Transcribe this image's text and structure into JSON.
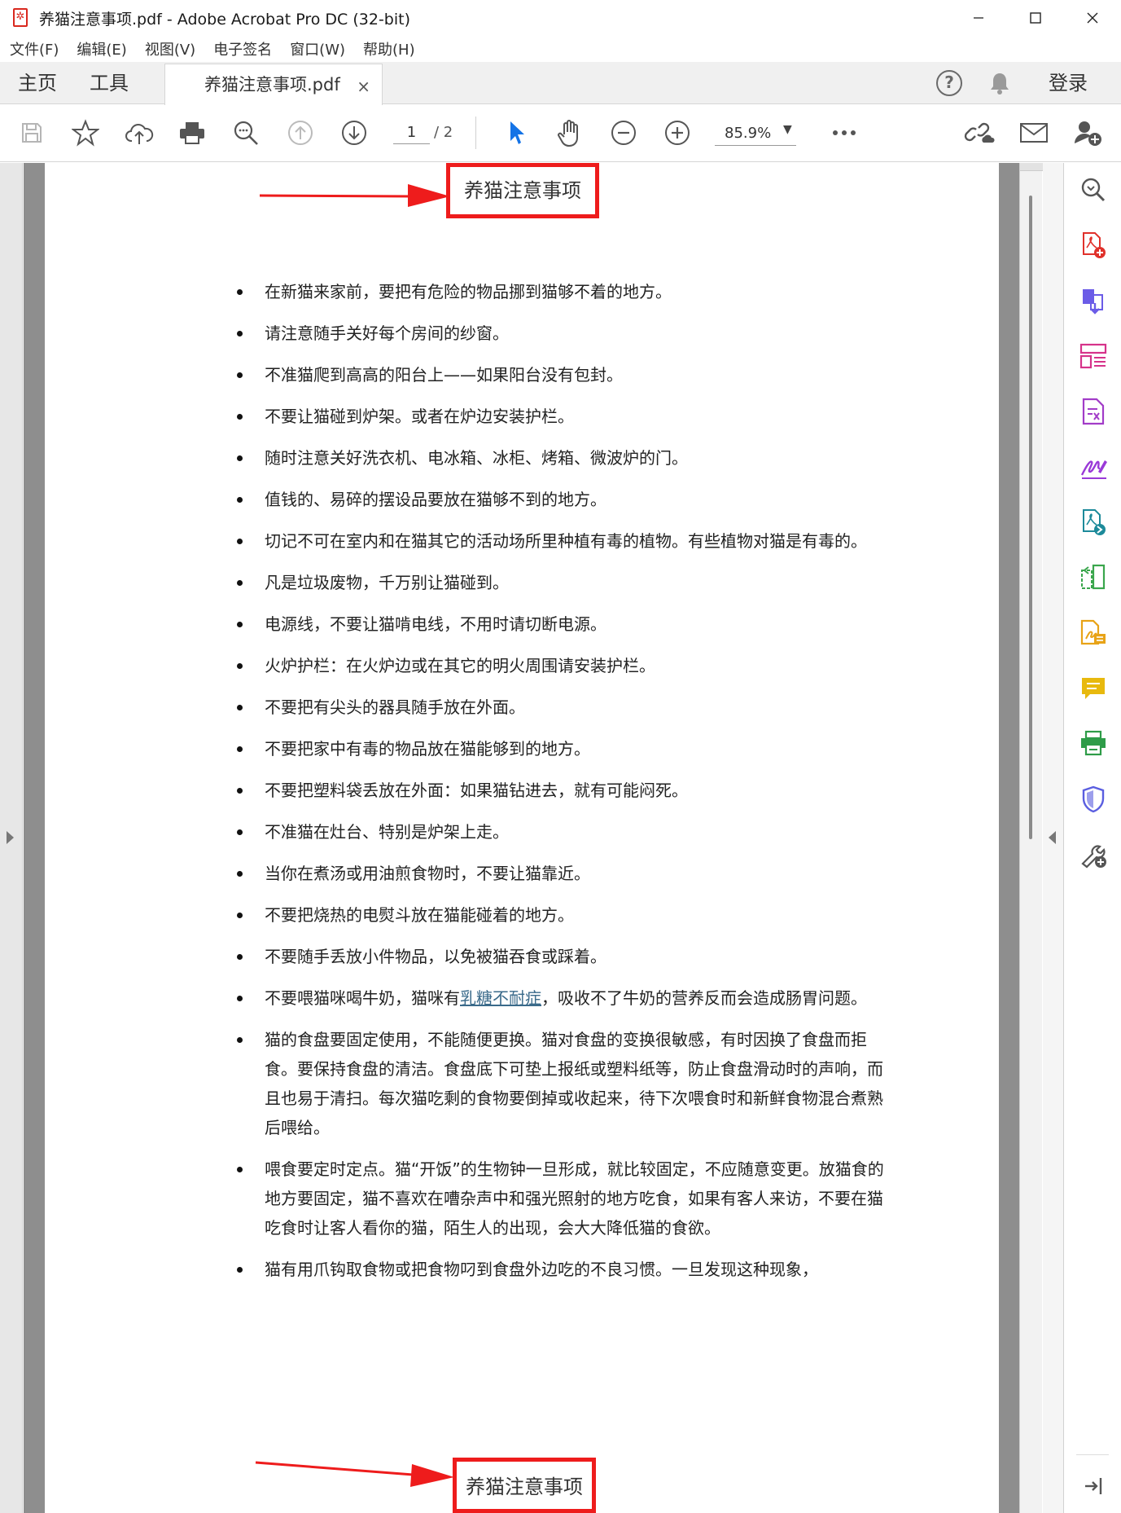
{
  "window": {
    "title": "养猫注意事项.pdf - Adobe Acrobat Pro DC (32-bit)"
  },
  "menu": [
    "文件(F)",
    "编辑(E)",
    "视图(V)",
    "电子签名",
    "窗口(W)",
    "帮助(H)"
  ],
  "tabs": {
    "home": "主页",
    "tools": "工具",
    "document": "养猫注意事项.pdf",
    "close": "×"
  },
  "header": {
    "help": "?",
    "login": "登录"
  },
  "toolbar": {
    "page_current": "1",
    "page_total": "/ 2",
    "zoom": "85.9%"
  },
  "document": {
    "title": "养猫注意事项",
    "bullets": [
      "在新猫来家前，要把有危险的物品挪到猫够不着的地方。",
      "请注意随手关好每个房间的纱窗。",
      "不准猫爬到高高的阳台上——如果阳台没有包封。",
      "不要让猫碰到炉架。或者在炉边安装护栏。",
      "随时注意关好洗衣机、电冰箱、冰柜、烤箱、微波炉的门。",
      "值钱的、易碎的摆设品要放在猫够不到的地方。",
      "切记不可在室内和在猫其它的活动场所里种植有毒的植物。有些植物对猫是有毒的。",
      "凡是垃圾废物，千万别让猫碰到。",
      "电源线，不要让猫啃电线，不用时请切断电源。",
      "火炉护栏：在火炉边或在其它的明火周围请安装护栏。",
      "不要把有尖头的器具随手放在外面。",
      "不要把家中有毒的物品放在猫能够到的地方。",
      "不要把塑料袋丢放在外面：如果猫钻进去，就有可能闷死。",
      "不准猫在灶台、特别是炉架上走。",
      "当你在煮汤或用油煎食物时，不要让猫靠近。",
      "不要把烧热的电熨斗放在猫能碰着的地方。",
      "不要随手丢放小件物品，以免被猫吞食或踩着。"
    ],
    "milk_bullet": {
      "before": "不要喂猫咪喝牛奶，猫咪有",
      "link": "乳糖不耐症",
      "after": "，吸收不了牛奶的营养反而会造成肠胃问题。"
    },
    "bullets_after": [
      "猫的食盘要固定使用，不能随便更换。猫对食盘的变换很敏感，有时因换了食盘而拒食。要保持食盘的清洁。食盘底下可垫上报纸或塑料纸等，防止食盘滑动时的声响，而且也易于清扫。每次猫吃剩的食物要倒掉或收起来，待下次喂食时和新鲜食物混合煮熟后喂给。",
      "喂食要定时定点。猫“开饭”的生物钟一旦形成，就比较固定，不应随意变更。放猫食的地方要固定，猫不喜欢在嘈杂声中和强光照射的地方吃食，如果有客人来访，不要在猫吃食时让客人看你的猫，陌生人的出现，会大大降低猫的食欲。",
      "猫有用爪钩取食物或把食物叼到食盘外边吃的不良习惯。一旦发现这种现象，"
    ],
    "footer_title": "养猫注意事项"
  },
  "colors": {
    "highlight_red": "#ee1c1c",
    "accent_blue": "#1473e6",
    "link": "#3a6a8a"
  },
  "tool_panel_icons": [
    "zoom-search-icon",
    "create-pdf-icon",
    "combine-files-icon",
    "organize-pages-icon",
    "edit-pdf-icon",
    "fill-sign-icon",
    "export-pdf-icon",
    "compare-files-icon",
    "request-signature-icon",
    "comment-icon",
    "print-production-icon",
    "protect-icon",
    "more-tools-icon",
    "expand-panel-icon"
  ]
}
